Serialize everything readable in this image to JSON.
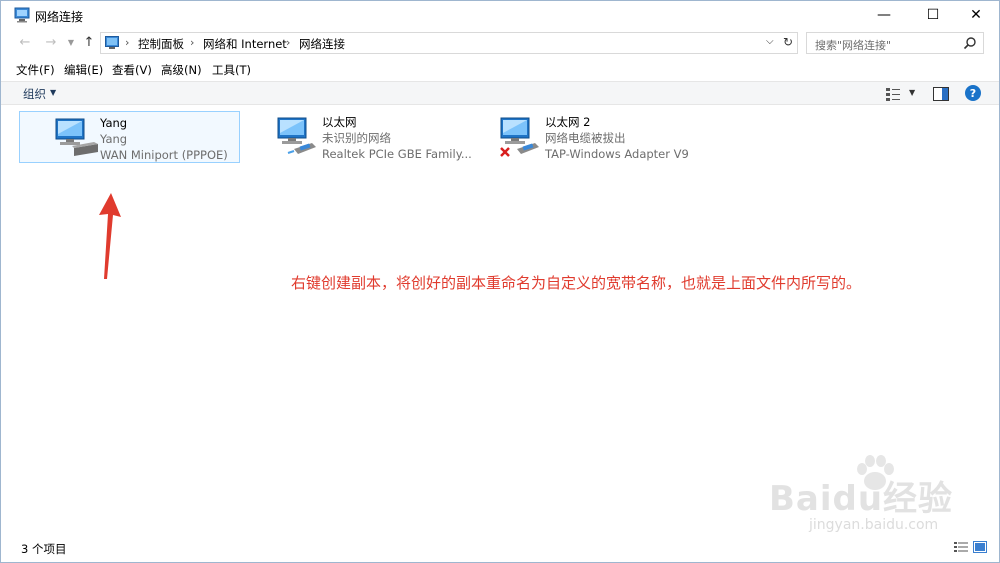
{
  "window": {
    "title": "网络连接",
    "min_glyph": "—",
    "max_glyph": "☐",
    "close_glyph": "✕"
  },
  "address": {
    "crumbs": [
      "控制面板",
      "网络和 Internet",
      "网络连接"
    ],
    "search_placeholder": "搜索\"网络连接\""
  },
  "menu": {
    "items": [
      "文件(F)",
      "编辑(E)",
      "查看(V)",
      "高级(N)",
      "工具(T)"
    ]
  },
  "command": {
    "organize_label": "组织"
  },
  "connections": [
    {
      "name": "Yang",
      "status": "Yang",
      "device": "WAN Miniport (PPPOE)",
      "selected": true,
      "icon": "dialup-connection-icon"
    },
    {
      "name": "以太网",
      "status": "未识别的网络",
      "device": "Realtek PCIe GBE Family...",
      "selected": false,
      "icon": "ethernet-connection-icon"
    },
    {
      "name": "以太网 2",
      "status": "网络电缆被拔出",
      "device": "TAP-Windows Adapter V9",
      "selected": false,
      "icon": "ethernet-disconnected-icon"
    }
  ],
  "annotation": {
    "text": "右键创建副本，将创好的副本重命名为自定义的宽带名称，也就是上面文件内所写的。",
    "color": "#e03b2e"
  },
  "status": {
    "item_count": "3 个项目"
  },
  "watermark": {
    "brand": "Baidu经验",
    "url": "jingyan.baidu.com"
  }
}
